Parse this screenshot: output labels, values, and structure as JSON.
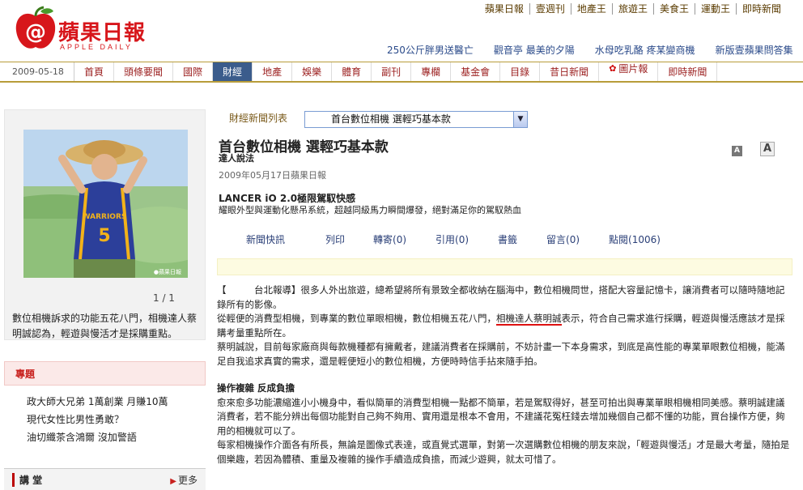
{
  "logo": {
    "name": "蘋果日報",
    "sub": "APPLE DAILY"
  },
  "top_nav": [
    "蘋果日報",
    "壹週刊",
    "地產王",
    "旅遊王",
    "美食王",
    "運動王",
    "即時新聞"
  ],
  "headlines": [
    "250公斤胖男送醫亡",
    "觀音亭 最美的夕陽",
    "水母吃乳酪 疼某變商機",
    "新版壹蘋果問答集"
  ],
  "main_nav": {
    "date": "2009-05-18",
    "items": [
      "首頁",
      "頭條要聞",
      "國際",
      "財經",
      "地產",
      "娛樂",
      "體育",
      "副刊",
      "專欄",
      "基金會",
      "目錄",
      "昔日新聞",
      "圖片報",
      "即時新聞"
    ],
    "active": "財經"
  },
  "photo": {
    "counter": "1 / 1",
    "caption": "數位相機訴求的功能五花八門，相機達人蔡明誠認為，輕遊與慢活才是採購重點。",
    "watermark": "●蘋果日報"
  },
  "topics": {
    "header": "專題",
    "items": [
      "政大師大兄弟 1萬創業 月賺10萬",
      "現代女性比男性勇敢？",
      "油切纖茶含鴻爾 沒加警語"
    ]
  },
  "lecture": {
    "label": "講 堂",
    "more": "更多"
  },
  "article_list": {
    "label": "財經新聞列表",
    "selected": "首台數位相機 選輕巧基本款"
  },
  "article": {
    "title": "首台數位相機 選輕巧基本款",
    "author": "達人說法",
    "date": "2009年05月17日蘋果日報",
    "font_small": "A",
    "font_large": "A"
  },
  "ad": {
    "title": "LANCER iO 2.0極限駕馭快感",
    "desc": "耀眼外型與運動化懸吊系統，超越同級馬力瞬間爆發，絕對滿足你的駕馭熱血"
  },
  "actions": [
    "新聞快訊",
    "列印",
    "轉寄(0)",
    "引用(0)",
    "書籤",
    "留言(0)",
    "點閱(1006)"
  ],
  "body": {
    "p1": "【　　　台北報導】很多人外出旅遊，總希望將所有景致全都收納在腦海中，數位相機問世，搭配大容量記憶卡，讓消費者可以隨時隨地記錄所有的影像。",
    "p2a": "從輕便的消費型相機，到專業的數位單眼相機，數位相機五花八門，",
    "p2hl": "相機達人蔡明誠",
    "p2b": "表示，符合自己需求進行採購，輕遊與慢活應該才是採購考量重點所在。",
    "p3": "蔡明誠說，目前每家廠商與每款機種都有擁戴者，建議消費者在採購前，不妨計畫一下本身需求，到底是高性能的專業單眼數位相機，能滿足自我追求真實的需求，還是輕便短小的數位相機，方便時時信手拈來隨手拍。",
    "h1": "操作複雜 反成負擔",
    "p4": "愈來愈多功能濃縮進小小機身中，看似簡單的消費型相機一點都不簡單，若是駕馭得好，甚至可拍出與專業單眼相機相同美感。蔡明誠建議消費者，若不能分辨出每個功能對自己夠不夠用、實用還是根本不會用，不建議花冤枉錢去增加幾個自己都不懂的功能，買台操作方便，夠用的相機就可以了。",
    "p5": "每家相機操作介面各有所長，無論是圖像式表達，或直覺式選單，對第一次選購數位相機的朋友來說，「輕遊與慢活」才是最大考量，隨拍是個樂趣，若因為體積、重量及複雜的操作手續造成負擔，而減少遊興，就太可惜了。"
  },
  "colors": {
    "accent_red": "#d7161b",
    "nav_active": "#3b5c8c",
    "gold_rule": "#b89c3a"
  }
}
